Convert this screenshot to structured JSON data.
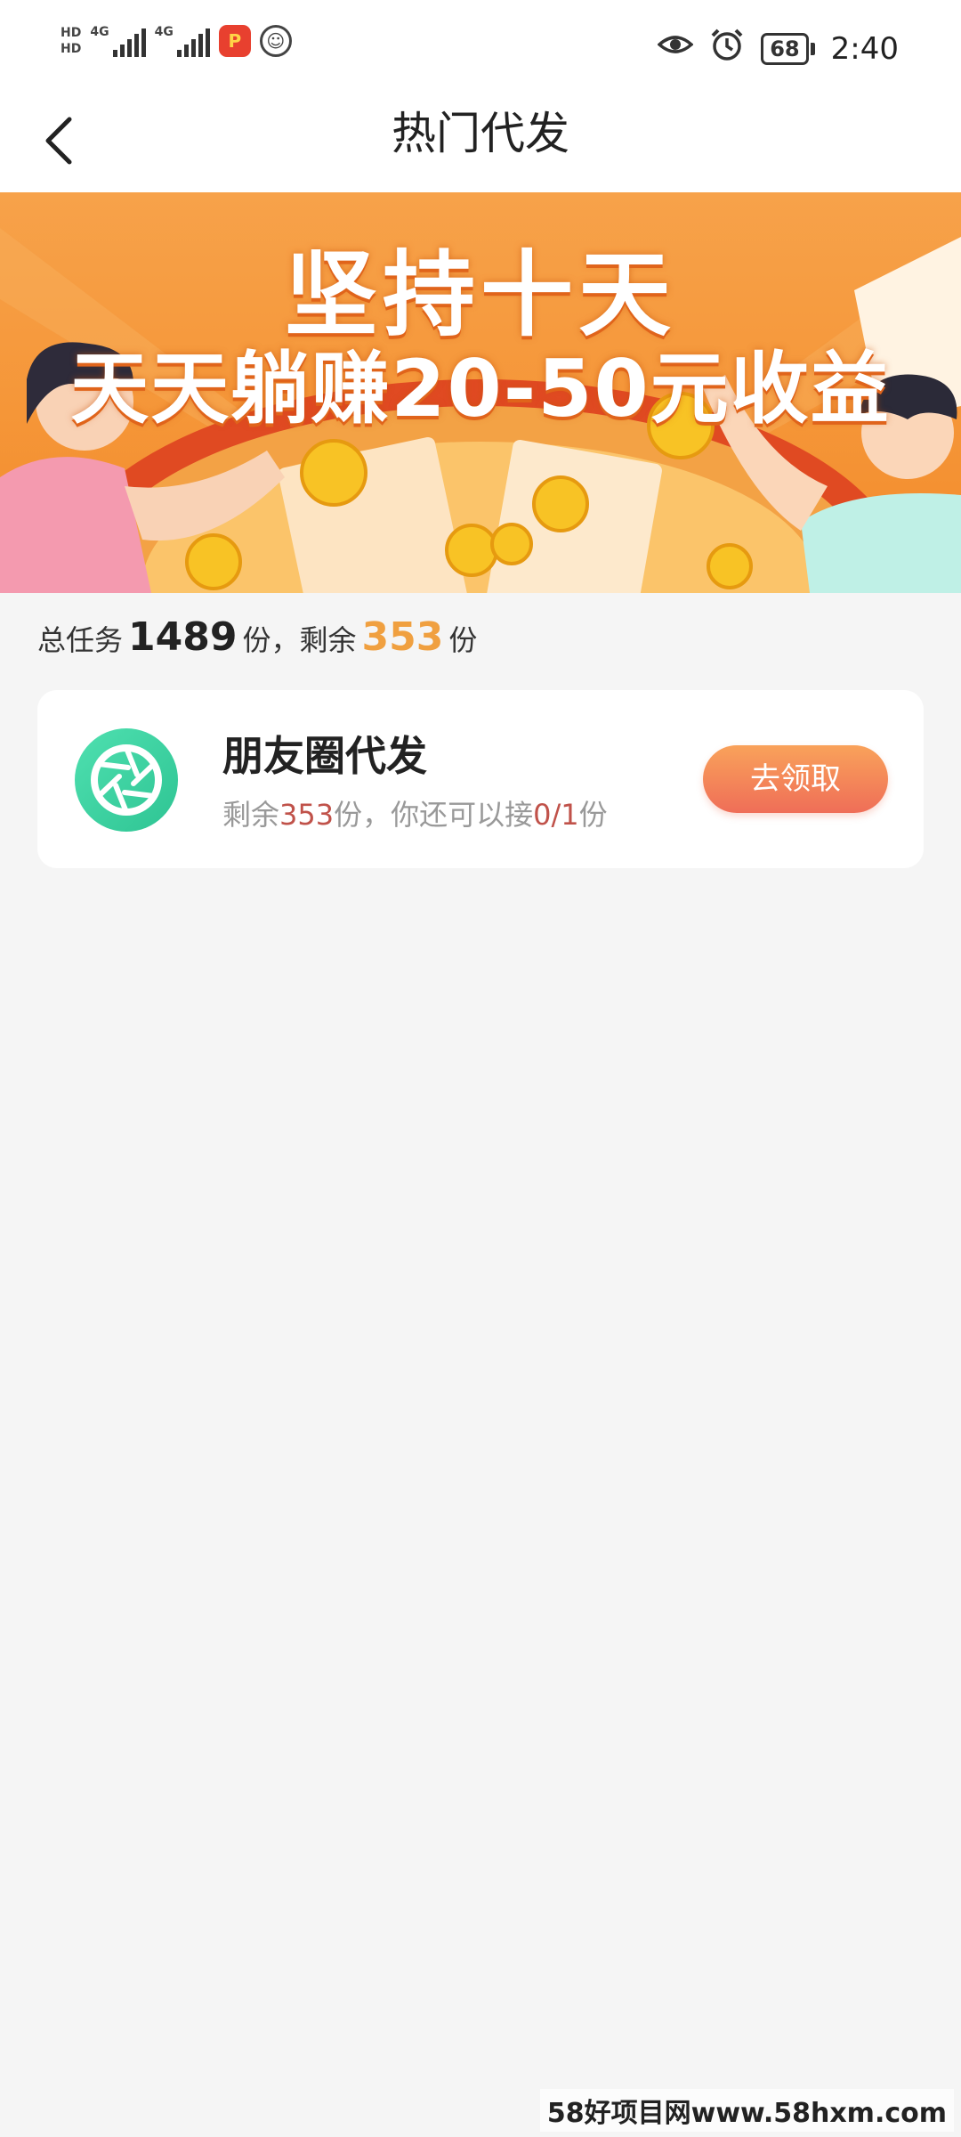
{
  "status_bar": {
    "hd_1": "HD",
    "hd_2": "HD",
    "network_1": "4G",
    "network_2": "4G",
    "battery": "68",
    "time": "2:40",
    "icons": [
      "eye-icon",
      "alarm-icon"
    ]
  },
  "header": {
    "title": "热门代发"
  },
  "banner": {
    "line1": "坚持十天",
    "line2": "天天躺赚20-50元收益"
  },
  "summary": {
    "prefix": "总任务",
    "total": "1489",
    "mid": "份，剩余",
    "remaining": "353",
    "suffix": "份"
  },
  "task": {
    "title": "朋友圈代发",
    "desc_prefix": "剩余",
    "desc_remaining": "353",
    "desc_mid": "份，你还可以接",
    "desc_quota": "0/1",
    "desc_suffix": "份",
    "button_label": "去领取"
  },
  "watermark": "58好项目网www.58hxm.com",
  "colors": {
    "accent_orange": "#f0a040",
    "button_start": "#f9a25a",
    "button_end": "#ef6e58",
    "highlight_red": "#c0524a",
    "icon_green": "#3fd4a0"
  }
}
